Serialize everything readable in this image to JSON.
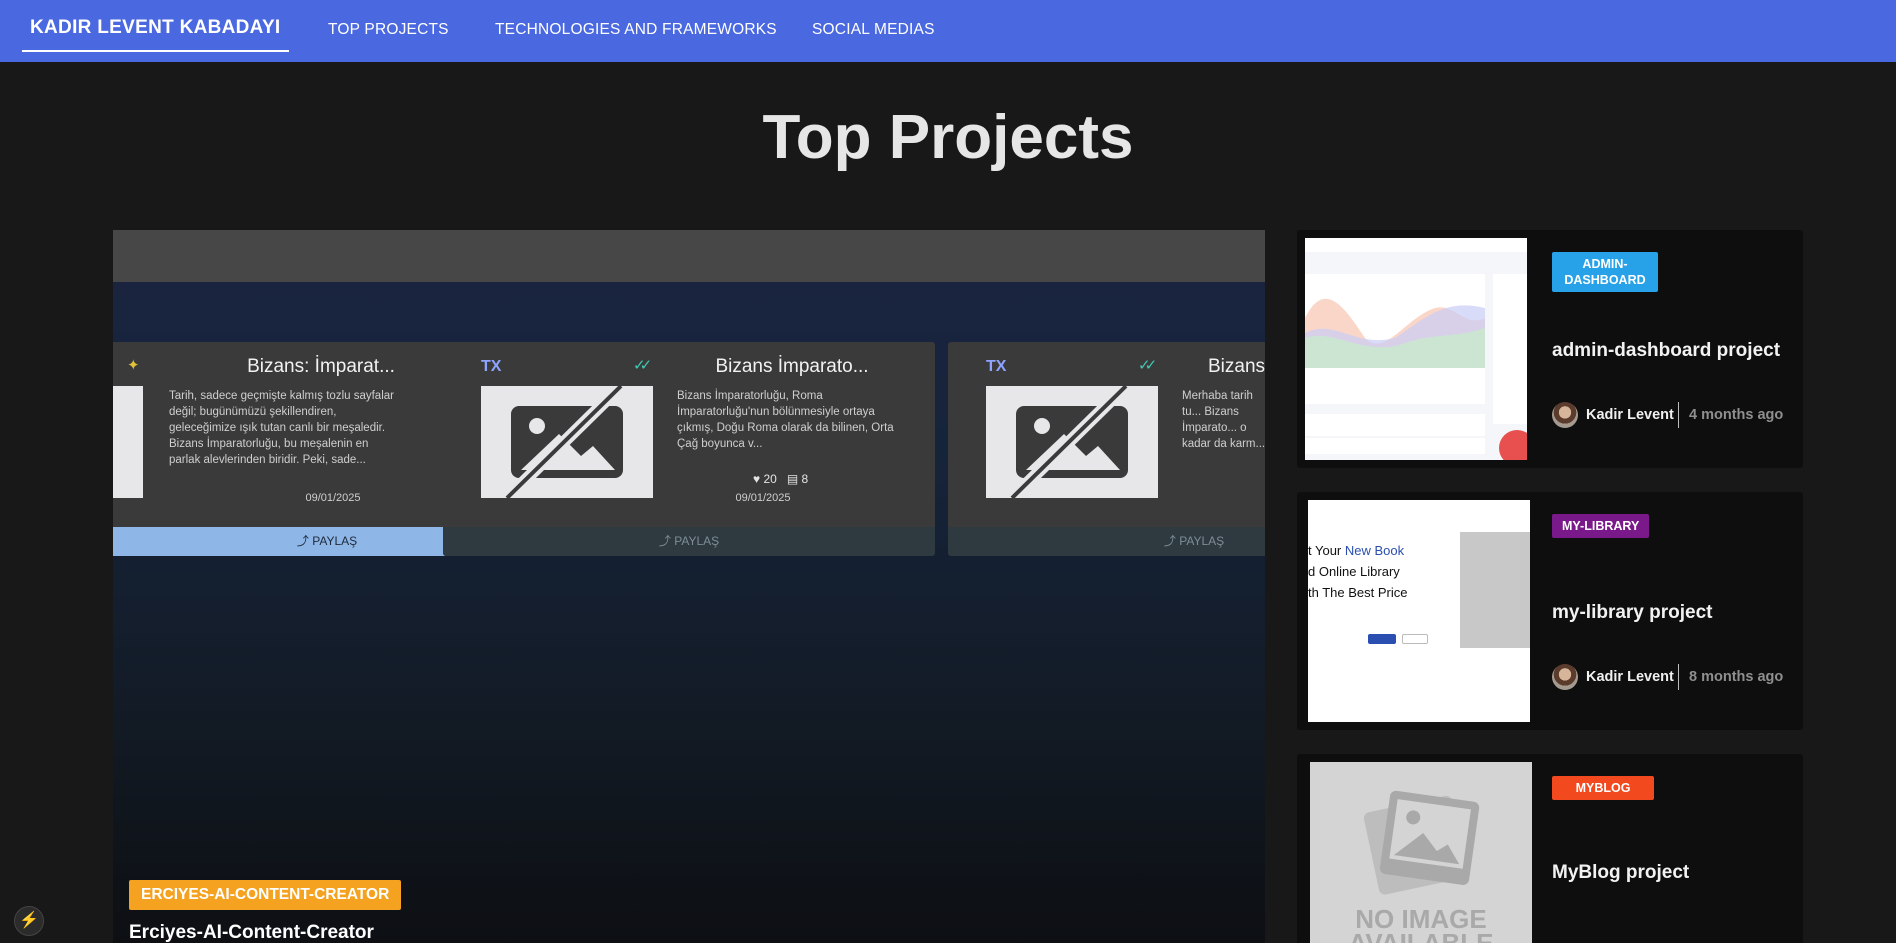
{
  "nav": {
    "brand": "KADIR LEVENT KABADAYI",
    "links": [
      "TOP PROJECTS",
      "TECHNOLOGIES AND FRAMEWORKS",
      "SOCIAL MEDIAS"
    ],
    "background": "#4a68e0"
  },
  "page": {
    "title": "Top Projects"
  },
  "featured": {
    "badge": "ERCIYES-AI-CONTENT-CREATOR",
    "badge_color": "#f4a21f",
    "title": "Erciyes-AI-Content-Creator",
    "preview_cards": [
      {
        "title": "Bizans: İmparat...",
        "description": "Tarih, sadece geçmişte kalmış tozlu sayfalar değil; bugünümüzü şekillendiren, geleceğimize ışık tutan canlı bir meşaledir. Bizans İmparatorluğu, bu meşalenin en parlak alevlerinden biridir. Peki, sade...",
        "date": "09/01/2025",
        "share": "PAYLAŞ"
      },
      {
        "tag": "TX",
        "title": "Bizans İmparato...",
        "description": "Bizans İmparatorluğu, Roma İmparatorluğu'nun bölünmesiyle ortaya çıkmış, Doğu Roma olarak da bilinen, Orta Çağ boyunca v...",
        "likes": "20",
        "comments": "8",
        "date": "09/01/2025",
        "share": "PAYLAŞ"
      },
      {
        "tag": "TX",
        "title": "Bizans",
        "description": "Merhaba tarih tu... Bizans İmparato... o kadar da karm...",
        "share": "PAYLAŞ"
      }
    ]
  },
  "side_projects": [
    {
      "badge": "ADMIN-DASHBOARD",
      "badge_color": "#27a2e8",
      "title": "admin-dashboard project",
      "author": "Kadir Levent",
      "ago": "4 months ago"
    },
    {
      "badge": "MY-LIBRARY",
      "badge_color": "#7a1a8a",
      "title": "my-library project",
      "author": "Kadir Levent",
      "ago": "8 months ago",
      "preview": {
        "line1": "t Your ",
        "line1_accent": "New Book",
        "line2": "d Online Library",
        "line3": "th The Best Price"
      }
    },
    {
      "badge": "MYBLOG",
      "badge_color": "#f2491e",
      "title": "MyBlog project",
      "no_image_text": "NO IMAGE AVAILABLE"
    }
  ]
}
